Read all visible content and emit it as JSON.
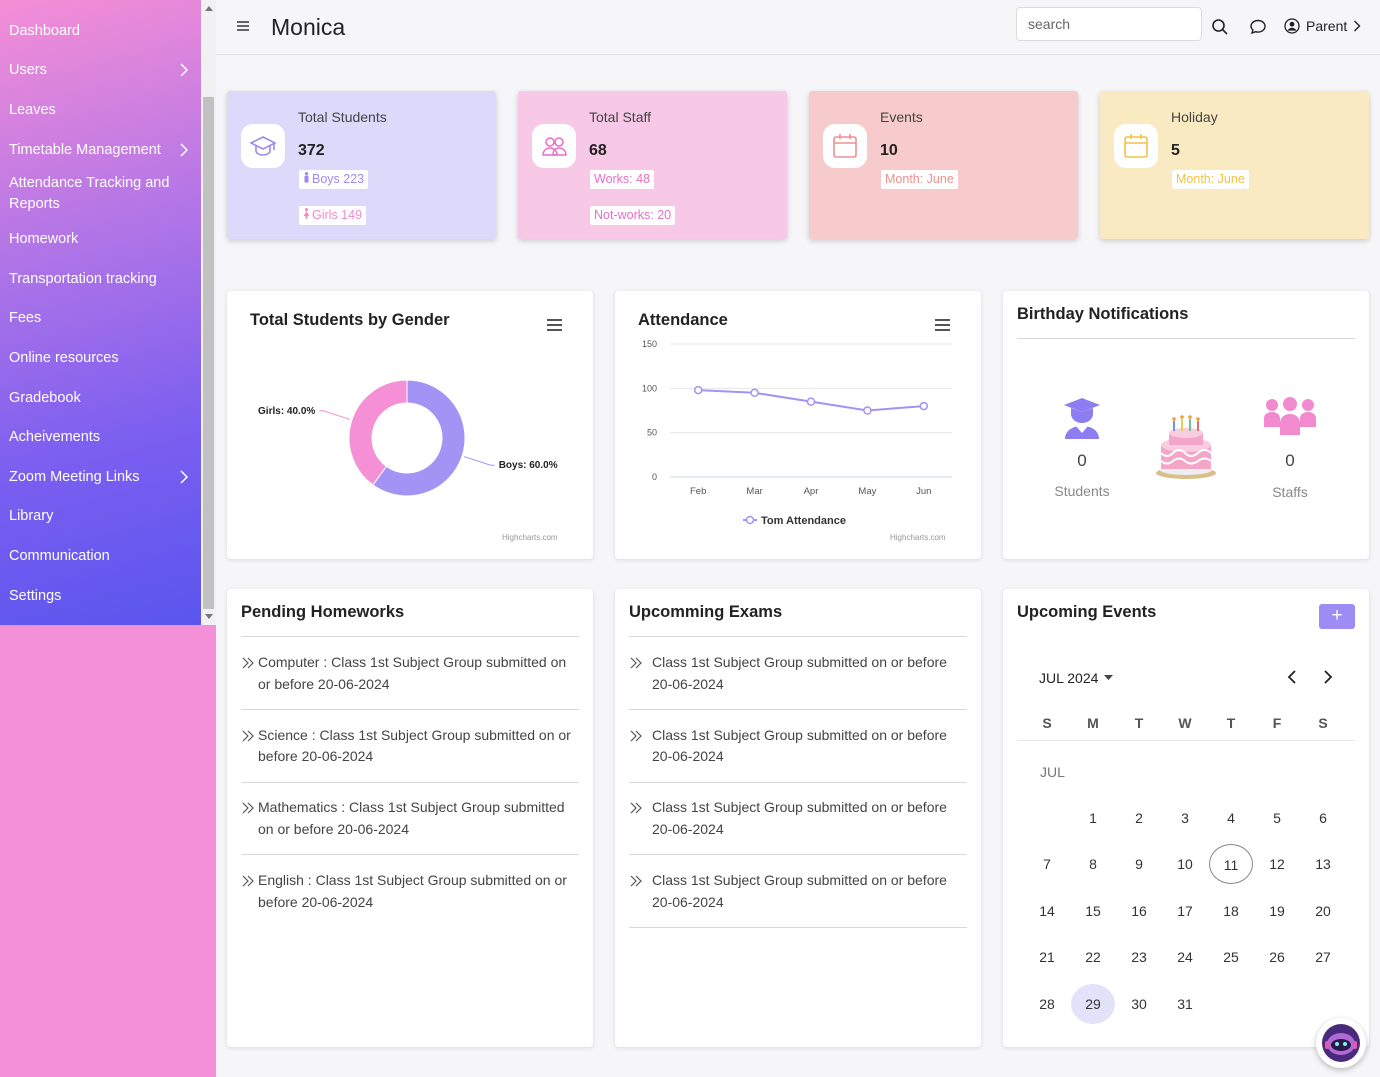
{
  "sidebar": {
    "items": [
      {
        "label": "Dashboard",
        "chevron": false
      },
      {
        "label": "Users",
        "chevron": true
      },
      {
        "label": "Leaves",
        "chevron": false
      },
      {
        "label": "Timetable Management",
        "chevron": true
      },
      {
        "label": "Attendance Tracking and Reports",
        "chevron": false
      },
      {
        "label": "Homework",
        "chevron": false
      },
      {
        "label": "Transportation tracking",
        "chevron": false
      },
      {
        "label": "Fees",
        "chevron": false
      },
      {
        "label": "Online resources",
        "chevron": false
      },
      {
        "label": "Gradebook",
        "chevron": false
      },
      {
        "label": "Acheivements",
        "chevron": false
      },
      {
        "label": "Zoom Meeting Links",
        "chevron": true
      },
      {
        "label": "Library",
        "chevron": false
      },
      {
        "label": "Communication",
        "chevron": false
      },
      {
        "label": "Settings",
        "chevron": false
      }
    ]
  },
  "header": {
    "brand": "Monica",
    "search_placeholder": "search",
    "user_label": "Parent"
  },
  "stats": [
    {
      "title": "Total Students",
      "value": "372",
      "badge1": "Boys 223",
      "badge2": "Girls 149",
      "bg": "#ddd9fb",
      "accent": "#9b8af0"
    },
    {
      "title": "Total Staff",
      "value": "68",
      "badge1": "Works: 48",
      "badge2": "Not-works: 20",
      "bg": "#f7c9e6",
      "accent": "#e86fc4"
    },
    {
      "title": "Events",
      "value": "10",
      "badge1": "Month: June",
      "bg": "#f7cbcb",
      "accent": "#ef8f8f"
    },
    {
      "title": "Holiday",
      "value": "5",
      "badge1": "Month: June",
      "bg": "#faeac2",
      "accent": "#f0c248"
    }
  ],
  "gender_chart": {
    "title": "Total Students by Gender",
    "credits": "Highcharts.com",
    "chart_data": {
      "type": "pie",
      "labels": [
        "Boys",
        "Girls"
      ],
      "values": [
        60.0,
        40.0
      ],
      "data_labels": [
        "Boys: 60.0%",
        "Girls: 40.0%"
      ],
      "colors": [
        "#a393f5",
        "#f590d6"
      ]
    }
  },
  "attendance_chart": {
    "title": "Attendance",
    "credits": "Highcharts.com",
    "chart_data": {
      "type": "line",
      "categories": [
        "Feb",
        "Mar",
        "Apr",
        "May",
        "Jun"
      ],
      "series": [
        {
          "name": "Tom Attendance",
          "values": [
            98,
            95,
            85,
            75,
            80
          ]
        }
      ],
      "ylim": [
        0,
        150
      ],
      "yticks": [
        "0",
        "50",
        "100",
        "150"
      ],
      "color": "#a393f5"
    }
  },
  "birthday": {
    "title": "Birthday Notifications",
    "students_count": "0",
    "students_label": "Students",
    "staffs_count": "0",
    "staffs_label": "Staffs"
  },
  "homeworks": {
    "title": "Pending Homeworks",
    "items": [
      {
        "line1": "Computer : Class 1st Subject Group submitted on",
        "line2": "or before 20-06-2024"
      },
      {
        "line1": "Science : Class 1st Subject Group submitted on or",
        "line2": "before 20-06-2024"
      },
      {
        "line1": "Mathematics : Class 1st Subject Group submitted",
        "line2": "on or before 20-06-2024"
      },
      {
        "line1": "English : Class 1st Subject Group submitted on or",
        "line2": "before 20-06-2024"
      }
    ]
  },
  "exams": {
    "title": "Upcomming Exams",
    "items": [
      {
        "line1": "Class 1st Subject Group submitted on or before",
        "line2": "20-06-2024"
      },
      {
        "line1": "Class 1st Subject Group submitted on or before",
        "line2": "20-06-2024"
      },
      {
        "line1": "Class 1st Subject Group submitted on or before",
        "line2": "20-06-2024"
      },
      {
        "line1": "Class 1st Subject Group submitted on or before",
        "line2": "20-06-2024"
      }
    ]
  },
  "events": {
    "title": "Upcoming Events",
    "add_label": "+",
    "month_label": "JUL 2024",
    "month_short": "JUL",
    "weekdays": [
      "S",
      "M",
      "T",
      "W",
      "T",
      "F",
      "S"
    ],
    "first_weekday": 1,
    "days_in_month": 31,
    "today": 11,
    "selected": 29
  }
}
